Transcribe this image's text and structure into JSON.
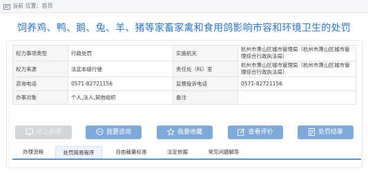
{
  "breadcrumb": {
    "label": "当前 位置：首页"
  },
  "page_title": "饲养鸡、鸭、鹅、兔、羊、猪等家畜家禽和食用鸽影响市容和环境卫生的处罚",
  "info": {
    "rows": [
      {
        "left_label": "权力事项类型",
        "left_value": "行政处罚",
        "right_label": "实施机关",
        "right_value": "杭州市萧山区城市管理局（杭州市萧山区城市管理综合行政执法局）"
      },
      {
        "left_label": "权力来源",
        "left_value": "法定本级行使",
        "right_label": "责任处（科）室",
        "right_value": "杭州市萧山区城市管理局（杭州市萧山区城市管理综合行政执法局）"
      },
      {
        "left_label": "咨询电话",
        "left_value": "0571-82721156",
        "right_label": "监督投诉电话",
        "right_value": "0571-82721156"
      },
      {
        "left_label": "办事对象",
        "left_value": "个人,法人,其他组织",
        "right_label": "备注",
        "right_value": ""
      }
    ]
  },
  "buttons": [
    {
      "label": "网上办理",
      "icon": "monitor-icon",
      "state": "disabled"
    },
    {
      "label": "我要咨询",
      "icon": "chat-icon",
      "state": "active"
    },
    {
      "label": "我要收藏",
      "icon": "star-icon",
      "state": "active"
    },
    {
      "label": "查看评价",
      "icon": "edit-icon",
      "state": "active"
    },
    {
      "label": "处罚结果",
      "icon": "document-icon",
      "state": "active"
    }
  ],
  "tabs": [
    {
      "label": "办理流程",
      "active": false
    },
    {
      "label": "处罚简易程序",
      "active": true
    },
    {
      "label": "自由裁量标准",
      "active": false
    },
    {
      "label": "法定依据",
      "active": false
    },
    {
      "label": "常见问题解答",
      "active": false
    }
  ],
  "colors": {
    "title": "#2a73c0",
    "button_active": "#7fa9d8",
    "button_disabled": "#d2d5da",
    "tab_underline": "#4f8fd6"
  }
}
